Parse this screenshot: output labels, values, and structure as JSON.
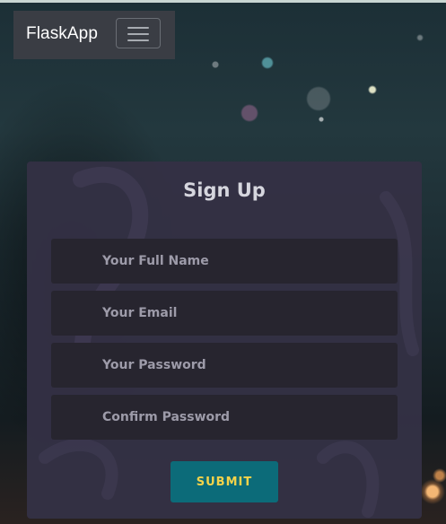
{
  "navbar": {
    "brand": "FlaskApp",
    "toggle_icon": "hamburger-menu-icon"
  },
  "form": {
    "title": "Sign Up",
    "fields": [
      {
        "placeholder": "Your Full Name",
        "value": ""
      },
      {
        "placeholder": "Your Email",
        "value": ""
      },
      {
        "placeholder": "Your Password",
        "value": ""
      },
      {
        "placeholder": "Confirm Password",
        "value": ""
      }
    ],
    "submit_label": "SUBMIT"
  },
  "colors": {
    "navbar_bg": "#3a3d44",
    "card_bg": "#34314a",
    "field_bg": "#27252f",
    "submit_bg": "#0c6b79",
    "submit_text": "#f5d34a"
  }
}
